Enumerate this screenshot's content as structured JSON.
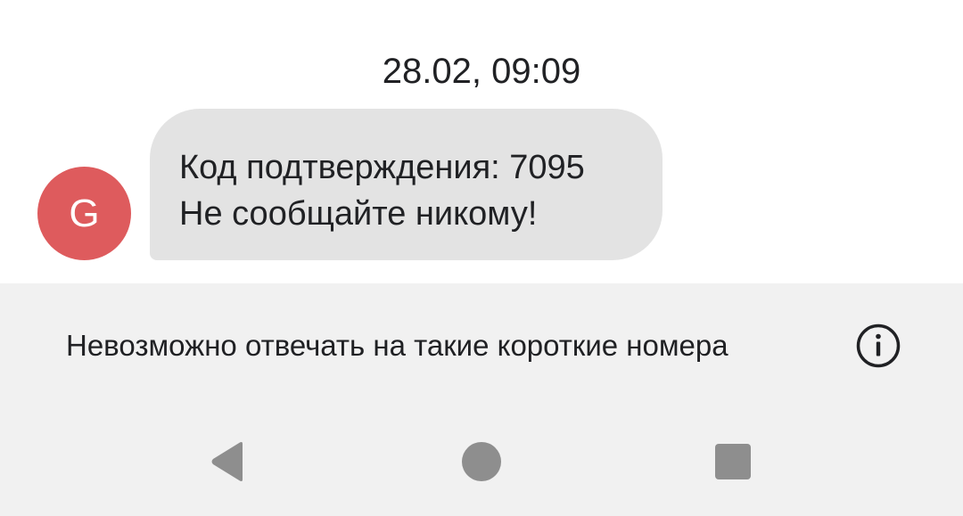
{
  "conversation": {
    "timestamp": "28.02, 09:09"
  },
  "message": {
    "sender_initial": "G",
    "avatar_color": "#de5b5d",
    "bubble_color": "#e3e3e3",
    "lines": [
      "Код подтверждения: 7095",
      "Не сообщайте никому!"
    ]
  },
  "footer": {
    "notice": "Невозможно отвечать на такие короткие номера",
    "info_icon": "info-circle-icon",
    "background": "#f1f1f1"
  },
  "navigation": {
    "back_icon": "back-triangle-icon",
    "home_icon": "home-circle-icon",
    "recents_icon": "recents-square-icon",
    "icon_color": "#8e8e8e"
  }
}
